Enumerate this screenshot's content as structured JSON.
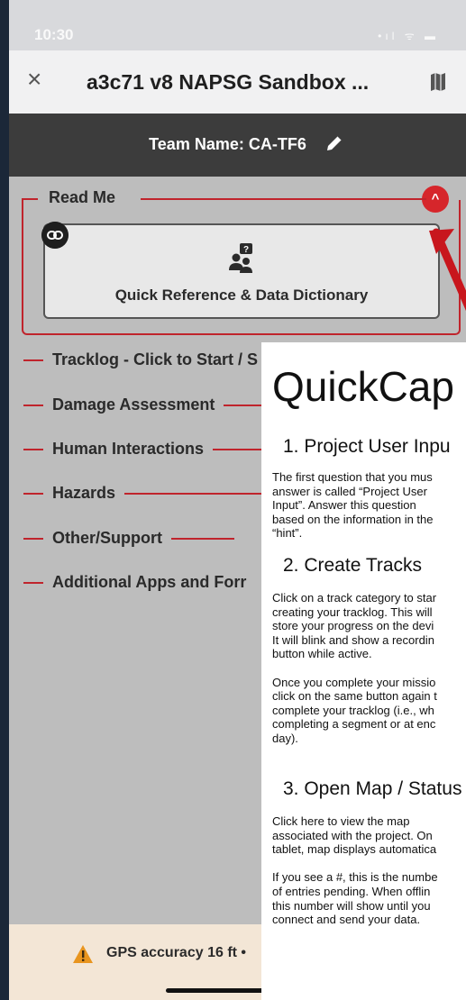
{
  "status_bar": {
    "time": "10:30",
    "signal_icons": "•ıl ᯤ ▬"
  },
  "nav": {
    "title": "a3c71 v8 NAPSG Sandbox ...",
    "close_icon": "close-icon",
    "map_icon": "map-icon"
  },
  "team": {
    "label": "Team Name: CA-TF6"
  },
  "readme": {
    "title": "Read Me",
    "button_label": "Quick Reference & Data Dictionary"
  },
  "sections": [
    "Tracklog - Click to Start / S",
    "Damage Assessment",
    "Human Interactions",
    "Hazards",
    "Other/Support",
    "Additional Apps and Forr"
  ],
  "gps": {
    "text": "GPS accuracy 16 ft •"
  },
  "document": {
    "title": "QuickCap",
    "s1_heading": "1. Project User Inpu",
    "s1_body": "The first question that you mus\nanswer is called “Project User\nInput”. Answer this question\nbased on the information in the\n“hint”.",
    "s2_heading": "2. Create Tracks",
    "s2_body": "Click on a track category to star\ncreating your tracklog. This will\nstore your progress on the devi\nIt will blink and show a recordin\nbutton while active.\n\nOnce you complete your missio\nclick on the same button again t\ncomplete your tracklog (i.e., wh\ncompleting a segment or at enc\nday).",
    "s3_heading": "3. Open Map / Status",
    "s3_body": "Click here to view the map\nassociated with the project. On\ntablet, map displays automatica\n\nIf you see a #, this is the numbe\nof entries pending. When offlin\nthis number will show until you\nconnect and send your data."
  },
  "colors": {
    "accent_red": "#c0242c",
    "chevron_red": "#d6262b",
    "team_bar": "#3c3c3c",
    "content_bg": "#bdbdbd",
    "warning_orange": "#e8951f"
  }
}
